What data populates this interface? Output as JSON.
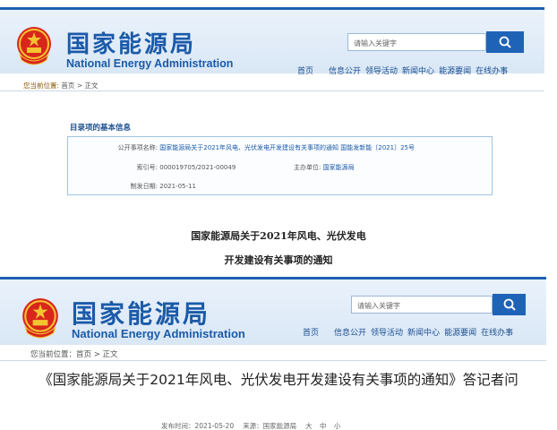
{
  "site": {
    "cn_title": "国家能源局",
    "en_title": "National Energy Administration",
    "search_placeholder": "请输入关键字",
    "nav": [
      "首页",
      "信息公开",
      "领导活动",
      "新闻中心",
      "能源要闻",
      "在线办事"
    ]
  },
  "top": {
    "breadcrumb": {
      "here": "您当前位置:",
      "home": "首页",
      "sep": ">",
      "current": "正文"
    },
    "info_heading": "目录项的基本信息",
    "info": {
      "public_item_label": "公开事项名称:",
      "public_item_value": "国家能源局关于2021年风电、光伏发电开发建设有关事项的通知 国能发新能〔2021〕25号",
      "index_label": "索引号:",
      "index_value": "000019705/2021-00049",
      "org_label": "主办单位:",
      "org_value": "国家能源局",
      "date_label": "制发日期:",
      "date_value": "2021-05-11"
    },
    "doc_title_line1": "国家能源局关于2021年风电、光伏发电",
    "doc_title_line2": "开发建设有关事项的通知"
  },
  "bottom": {
    "breadcrumb": "您当前位置：首页 > 正文",
    "article_title": "《国家能源局关于2021年风电、光伏发电开发建设有关事项的通知》答记者问",
    "publish_time": "发布时间：2021-05-20",
    "source": "来源：国家能源局",
    "font_sizes": [
      "大",
      "中",
      "小"
    ]
  },
  "colors": {
    "brand_blue": "#1b5aa8",
    "button_blue": "#1f63b6",
    "header_bg": "#d9e7f6"
  }
}
